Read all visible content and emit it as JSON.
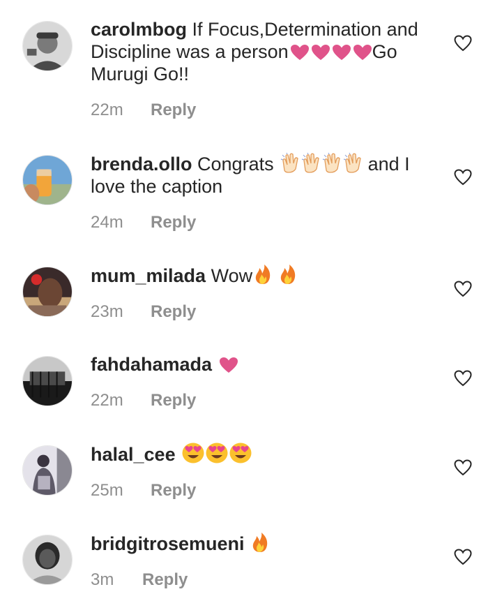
{
  "comments": [
    {
      "username": "carolmbog",
      "text_before": "If Focus,Determination and Discipline was a person",
      "emojis": [
        "heart",
        "heart",
        "heart",
        "heart"
      ],
      "text_after": "Go Murugi Go!!",
      "time": "22m",
      "reply_label": "Reply"
    },
    {
      "username": "brenda.ollo",
      "text_before": "Congrats",
      "emojis": [
        "clap",
        "clap",
        "clap",
        "clap"
      ],
      "text_after": "and I love the caption",
      "time": "24m",
      "reply_label": "Reply"
    },
    {
      "username": "mum_milada",
      "text_before": "Wow",
      "emojis": [
        "fire",
        "fire"
      ],
      "text_after": "",
      "time": "23m",
      "reply_label": "Reply"
    },
    {
      "username": "fahdahamada",
      "text_before": "",
      "emojis": [
        "heart"
      ],
      "text_after": "",
      "time": "22m",
      "reply_label": "Reply"
    },
    {
      "username": "halal_cee",
      "text_before": "",
      "emojis": [
        "heart-eyes",
        "heart-eyes",
        "heart-eyes"
      ],
      "text_after": "",
      "time": "25m",
      "reply_label": "Reply"
    },
    {
      "username": "bridgitrosemueni",
      "text_before": "",
      "emojis": [
        "fire"
      ],
      "text_after": "",
      "time": "3m",
      "reply_label": "Reply"
    }
  ],
  "colors": {
    "username": "#262626",
    "meta": "#8e8e8e",
    "heart_emoji": "#e0538a",
    "like_icon": "#262626"
  },
  "icons": {
    "like": "heart-outline-icon",
    "avatar": "user-avatar"
  }
}
